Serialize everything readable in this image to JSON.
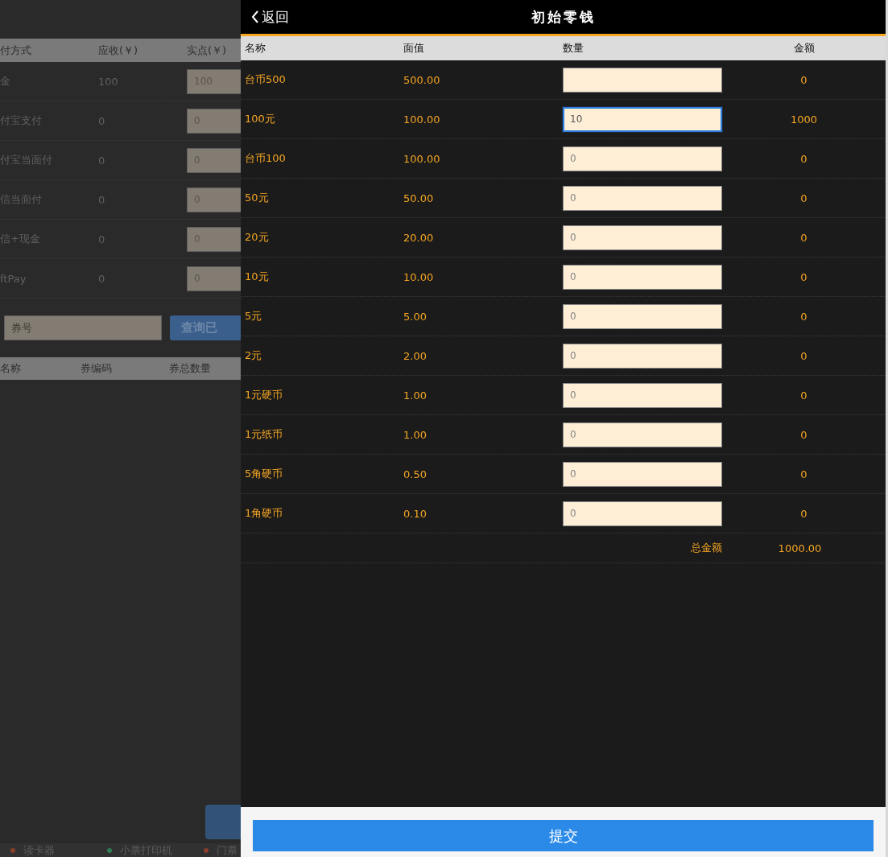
{
  "background": {
    "payment_table": {
      "columns": [
        "付方式",
        "应收(￥)",
        "实点(￥)"
      ],
      "rows": [
        {
          "method": "金",
          "due": "100",
          "paid": "100"
        },
        {
          "method": "付宝支付",
          "due": "0",
          "paid": "0"
        },
        {
          "method": "付宝当面付",
          "due": "0",
          "paid": "0"
        },
        {
          "method": "信当面付",
          "due": "0",
          "paid": "0"
        },
        {
          "method": "信+现金",
          "due": "0",
          "paid": "0"
        },
        {
          "method": "ftPay",
          "due": "0",
          "paid": "0"
        }
      ]
    },
    "voucher": {
      "placeholder": "券号",
      "button": "查询已"
    },
    "voucher_table": {
      "columns": [
        "名称",
        "券编码",
        "券总数量"
      ]
    },
    "devices": [
      {
        "name": "读卡器",
        "color": "#8a3f2c"
      },
      {
        "name": "小票打印机",
        "color": "#2f7d52"
      },
      {
        "name": "门票",
        "color": "#8a3f2c"
      }
    ]
  },
  "dialog": {
    "back": "返回",
    "title": "初始零钱",
    "columns": [
      "名称",
      "面值",
      "数量",
      "金额"
    ],
    "rows": [
      {
        "name": "台币500",
        "value": "500.00",
        "focused": false,
        "amount": "0"
      },
      {
        "name": "100元",
        "value": "100.00",
        "quantity": "10",
        "focused": true,
        "amount": "1000"
      },
      {
        "name": "台币100",
        "value": "100.00",
        "placeholder": "0",
        "focused": false,
        "amount": "0"
      },
      {
        "name": "50元",
        "value": "50.00",
        "placeholder": "0",
        "focused": false,
        "amount": "0"
      },
      {
        "name": "20元",
        "value": "20.00",
        "placeholder": "0",
        "focused": false,
        "amount": "0"
      },
      {
        "name": "10元",
        "value": "10.00",
        "placeholder": "0",
        "focused": false,
        "amount": "0"
      },
      {
        "name": "5元",
        "value": "5.00",
        "placeholder": "0",
        "focused": false,
        "amount": "0"
      },
      {
        "name": "2元",
        "value": "2.00",
        "placeholder": "0",
        "focused": false,
        "amount": "0"
      },
      {
        "name": "1元硬币",
        "value": "1.00",
        "placeholder": "0",
        "focused": false,
        "amount": "0"
      },
      {
        "name": "1元纸币",
        "value": "1.00",
        "placeholder": "0",
        "focused": false,
        "amount": "0"
      },
      {
        "name": "5角硬币",
        "value": "0.50",
        "placeholder": "0",
        "focused": false,
        "amount": "0"
      },
      {
        "name": "1角硬币",
        "value": "0.10",
        "placeholder": "0",
        "focused": false,
        "amount": "0"
      }
    ],
    "total_label": "总金额",
    "total": "1000.00",
    "submit": "提交"
  }
}
